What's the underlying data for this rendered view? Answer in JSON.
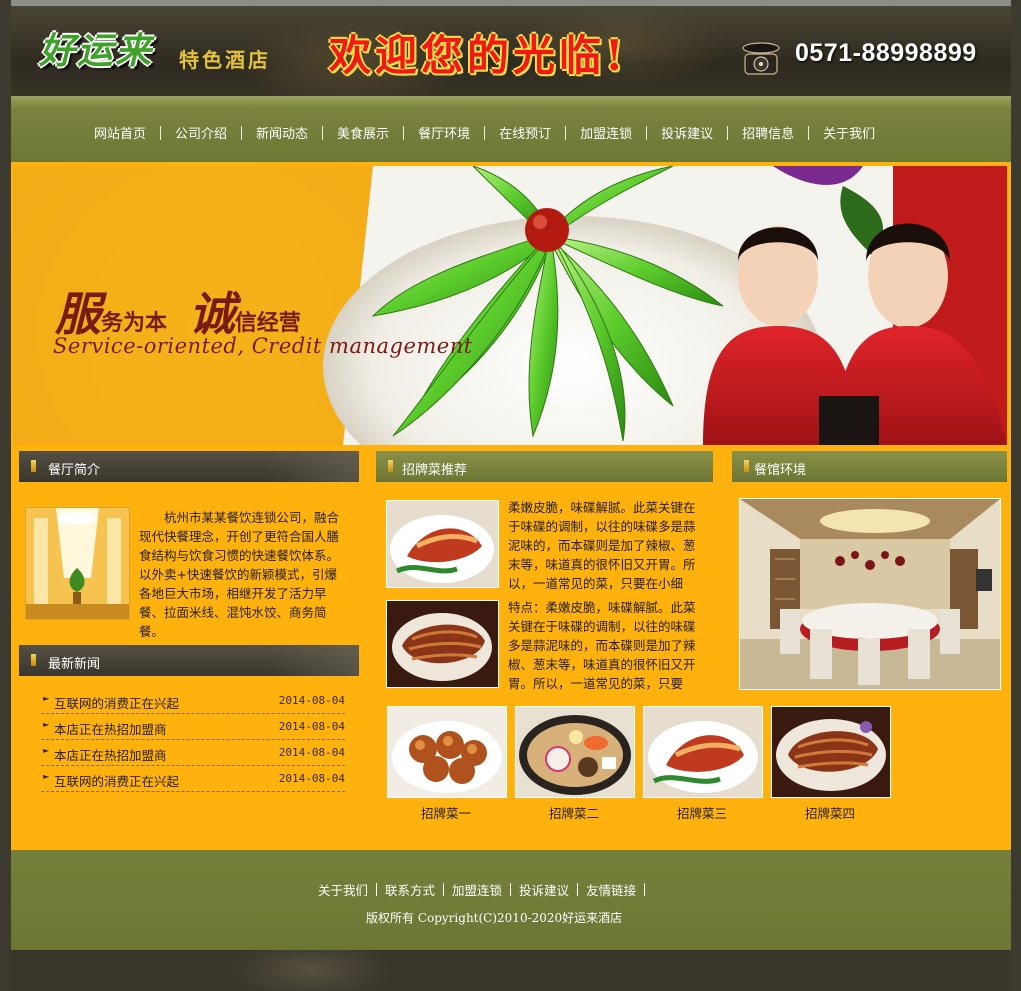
{
  "header": {
    "logo_main": "好运来",
    "logo_sub": "特色酒店",
    "welcome": "欢迎您的光临!",
    "phone": "0571-88998899"
  },
  "nav": [
    "网站首页",
    "公司介绍",
    "新闻动态",
    "美食展示",
    "餐厅环境",
    "在线预订",
    "加盟连锁",
    "投诉建议",
    "招聘信息",
    "关于我们"
  ],
  "banner": {
    "slogan_char1": "服",
    "slogan_part1": "务为本",
    "slogan_char2": "诚",
    "slogan_part2": "信经营",
    "slogan_en": "Service-oriented, Credit management"
  },
  "intro": {
    "title": "餐厅简介",
    "text": "杭州市某某餐饮连锁公司，融合现代快餐理念，开创了更符合国人膳食结构与饮食习惯的快速餐饮体系。以外卖+快速餐饮的新颖模式，引爆各地巨大市场，相继开发了活力早餐、拉面米线、混饨水饺、商务简餐。"
  },
  "news": {
    "title": "最新新闻",
    "items": [
      {
        "title": "互联网的消费正在兴起",
        "date": "2014-08-04"
      },
      {
        "title": "本店正在热招加盟商",
        "date": "2014-08-04"
      },
      {
        "title": "本店正在热招加盟商",
        "date": "2014-08-04"
      },
      {
        "title": "互联网的消费正在兴起",
        "date": "2014-08-04"
      }
    ]
  },
  "dishes": {
    "title": "招牌菜推荐",
    "text1": "柔嫩皮脆，味碟解腻。此菜关键在于味碟的调制，以往的味碟多是蒜泥味的，而本碟则是加了辣椒、葱末等，味道真的很怀旧又开胃。所以，一道常见的菜，只要在小细",
    "text2": "特点：柔嫩皮脆，味碟解腻。此菜关键在于味碟的调制，以往的味碟多是蒜泥味的，而本碟则是加了辣椒、葱末等，味道真的很怀旧又开胃。所以，一道常见的菜，只要",
    "captions": [
      "招牌菜一",
      "招牌菜二",
      "招牌菜三",
      "招牌菜四"
    ]
  },
  "hall": {
    "title": "餐馆环境"
  },
  "footer": {
    "links": [
      "关于我们",
      "联系方式",
      "加盟连锁",
      "投诉建议",
      "友情链接"
    ],
    "copyright": "版权所有 Copyright(C)2010-2020好运来酒店"
  }
}
